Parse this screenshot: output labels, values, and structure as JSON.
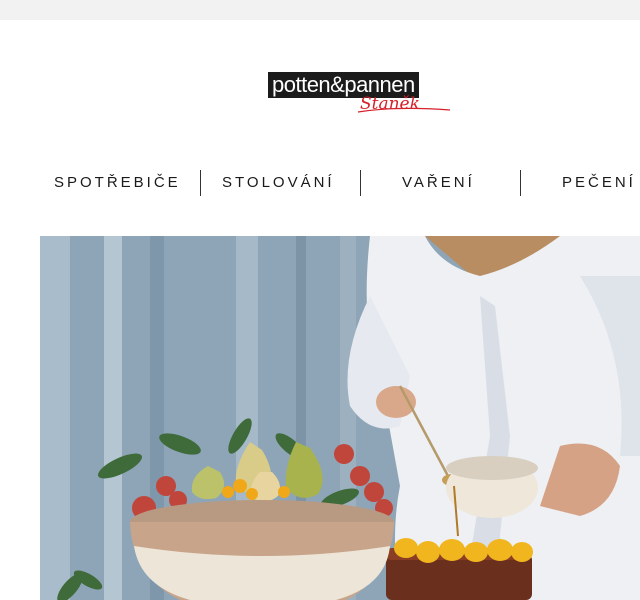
{
  "header": {
    "logo_text": "potten&pannen",
    "logo_subtext": "Staněk"
  },
  "nav": {
    "items": [
      {
        "label": "SPOTŘEBIČE"
      },
      {
        "label": "STOLOVÁNÍ"
      },
      {
        "label": "VAŘENÍ"
      },
      {
        "label": "PEČENÍ"
      }
    ]
  },
  "colors": {
    "logo_red": "#d6202a",
    "logo_black": "#1b1b1b",
    "hero_wall": "#8fa6b8"
  },
  "hero": {
    "image": "kitchen-baking-banner"
  }
}
